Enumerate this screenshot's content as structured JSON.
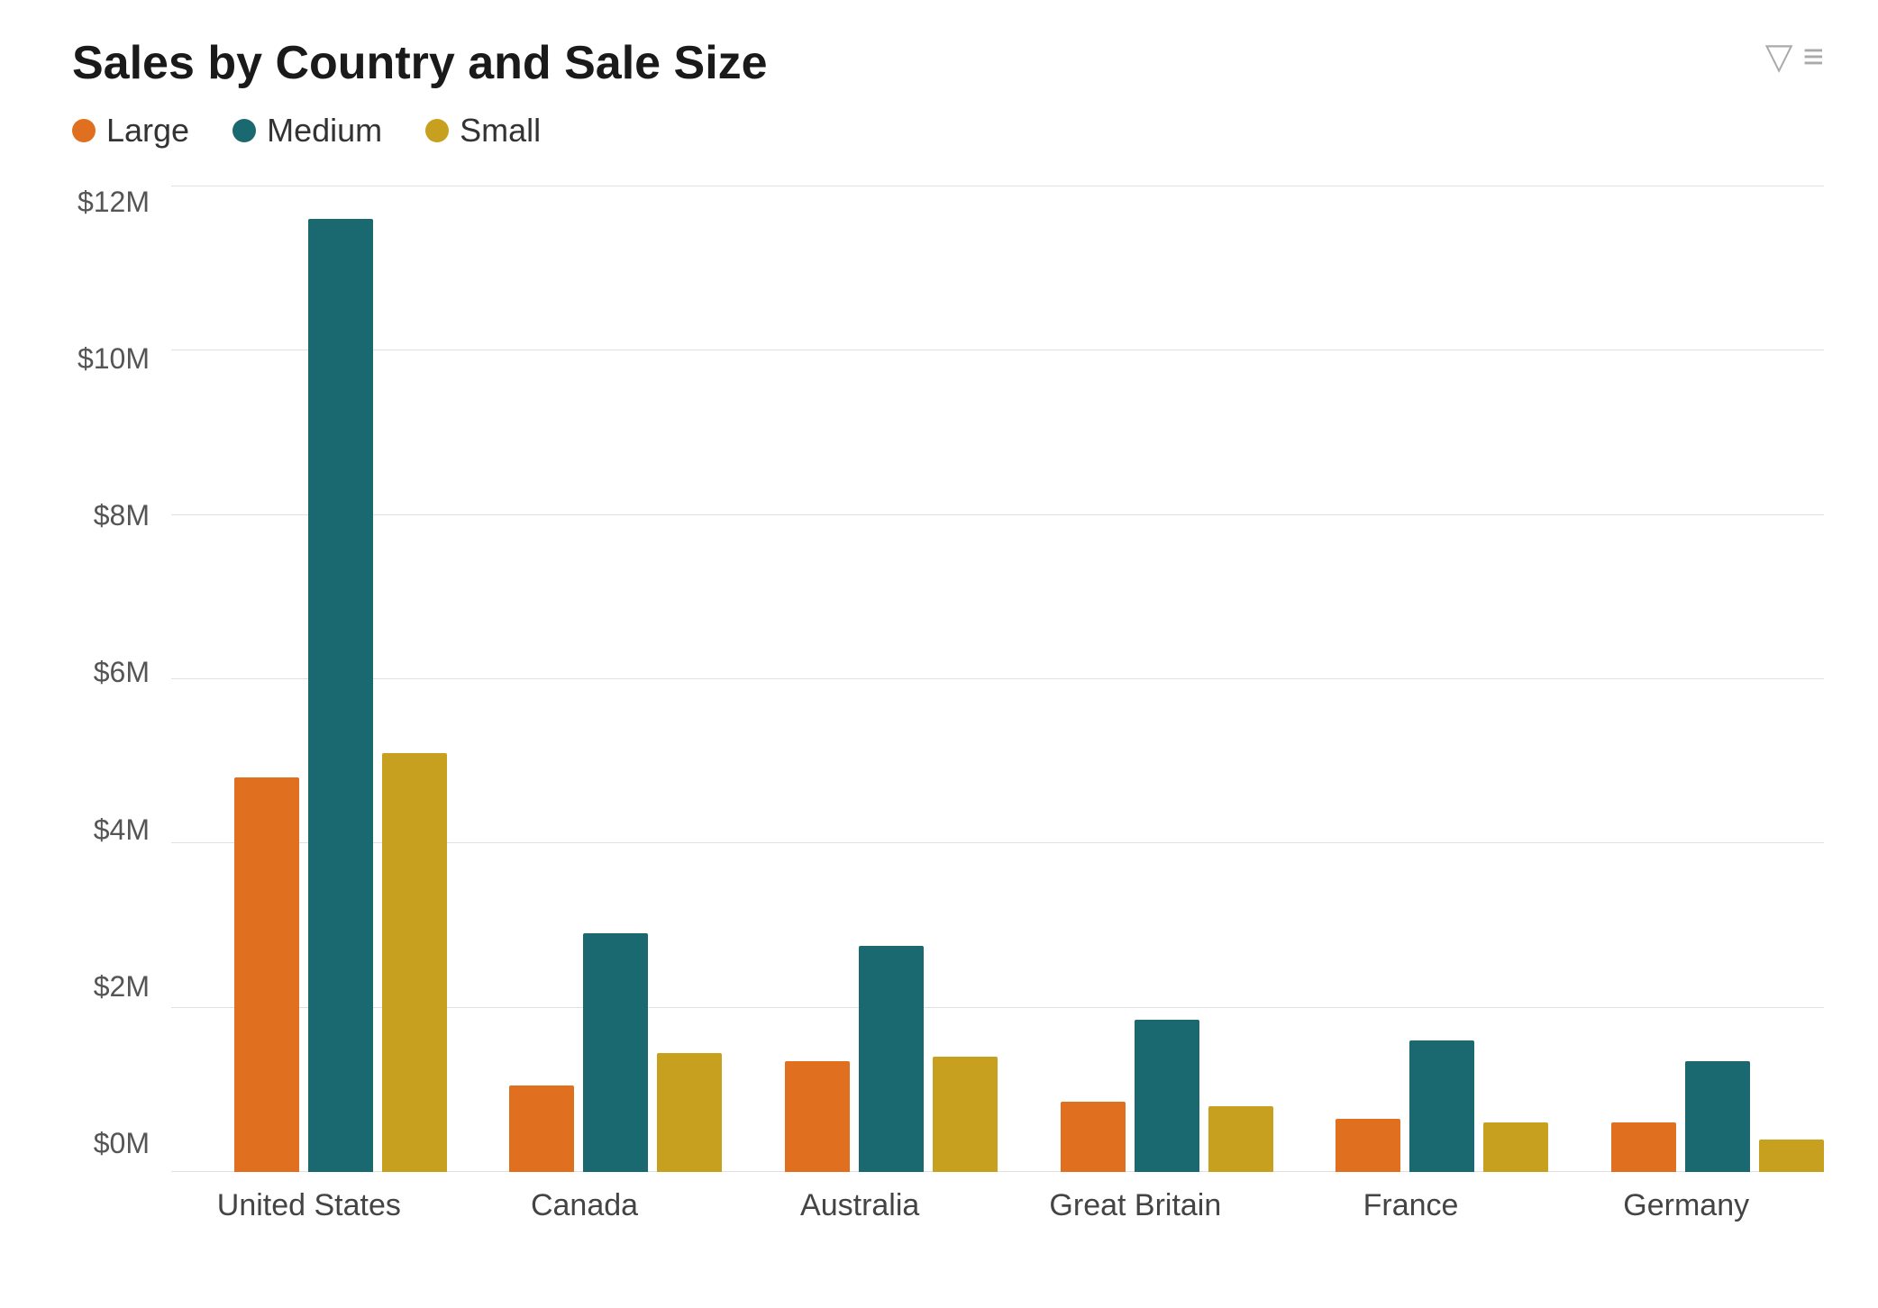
{
  "title": "Sales by Country and Sale Size",
  "filter_icon": "⛉",
  "legend": [
    {
      "id": "large",
      "label": "Large",
      "color": "#E07020"
    },
    {
      "id": "medium",
      "label": "Medium",
      "color": "#1A6870"
    },
    {
      "id": "small",
      "label": "Small",
      "color": "#C8A020"
    }
  ],
  "y_axis": {
    "labels": [
      "$0M",
      "$2M",
      "$4M",
      "$6M",
      "$8M",
      "$10M",
      "$12M"
    ],
    "max": 12
  },
  "countries": [
    {
      "name": "United States",
      "large": 4.8,
      "medium": 11.6,
      "small": 5.1
    },
    {
      "name": "Canada",
      "large": 1.05,
      "medium": 2.9,
      "small": 1.45
    },
    {
      "name": "Australia",
      "large": 1.35,
      "medium": 2.75,
      "small": 1.4
    },
    {
      "name": "Great Britain",
      "large": 0.85,
      "medium": 1.85,
      "small": 0.8
    },
    {
      "name": "France",
      "large": 0.65,
      "medium": 1.6,
      "small": 0.6
    },
    {
      "name": "Germany",
      "large": 0.6,
      "medium": 1.35,
      "small": 0.4
    }
  ]
}
